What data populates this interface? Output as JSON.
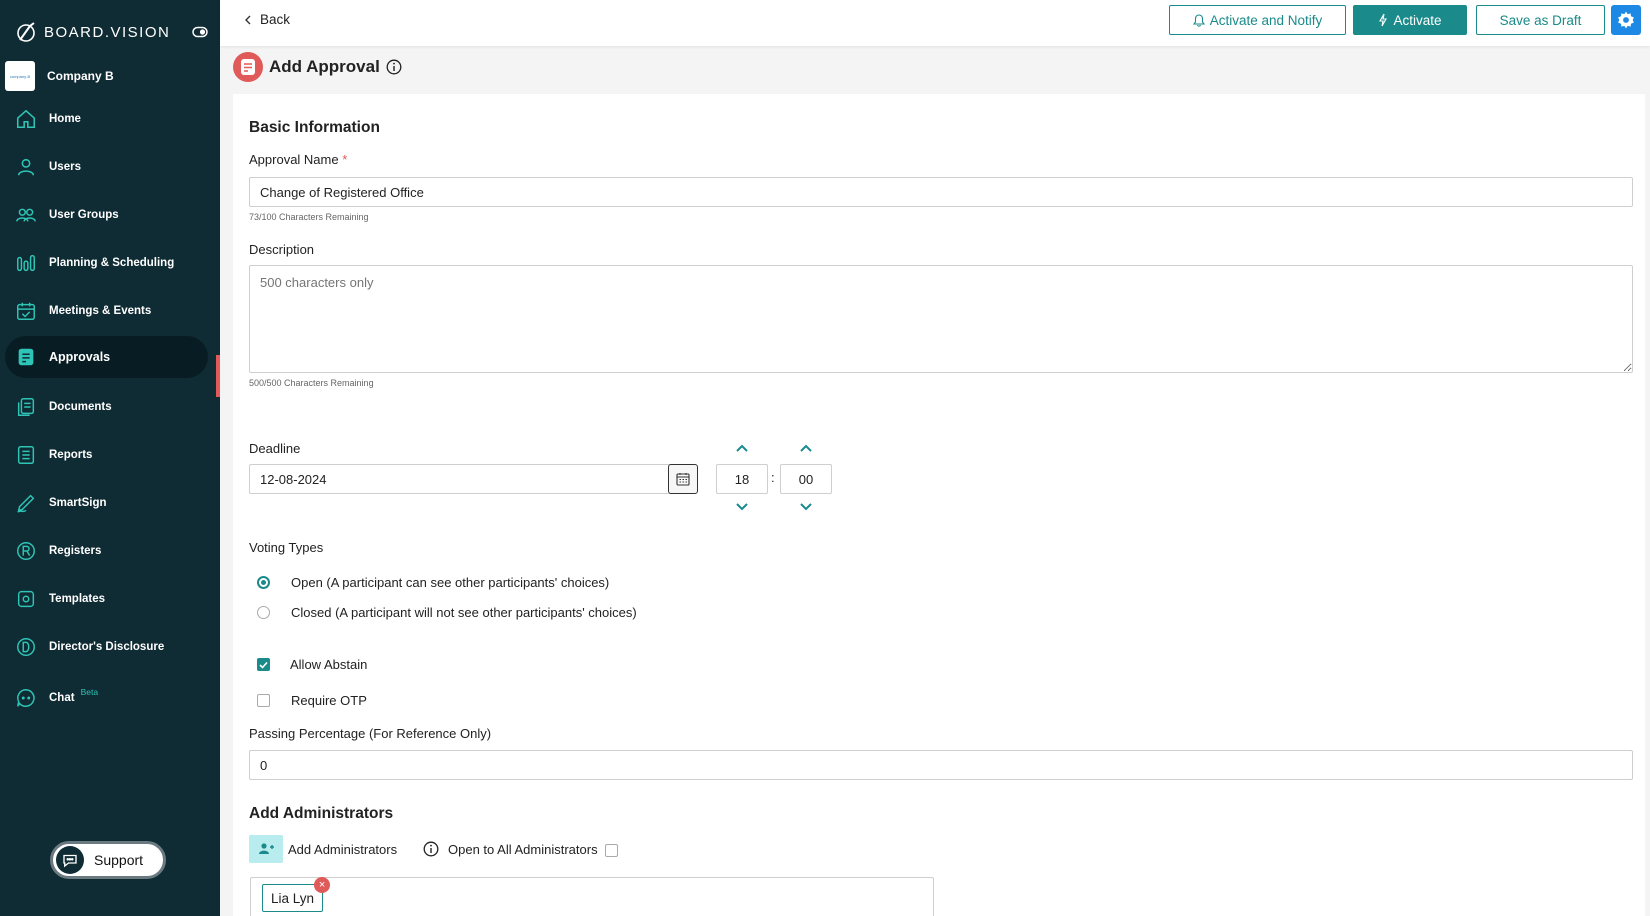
{
  "brand": {
    "name": "BOARD.VISION"
  },
  "company": {
    "name": "Company B",
    "logo_text": "company-B"
  },
  "sidebar": {
    "items": [
      {
        "label": "Home",
        "icon": "home-icon"
      },
      {
        "label": "Users",
        "icon": "user-icon"
      },
      {
        "label": "User Groups",
        "icon": "user-groups-icon"
      },
      {
        "label": "Planning & Scheduling",
        "icon": "planning-icon"
      },
      {
        "label": "Meetings & Events",
        "icon": "calendar-icon"
      },
      {
        "label": "Approvals",
        "icon": "approvals-icon",
        "active": true
      },
      {
        "label": "Documents",
        "icon": "documents-icon"
      },
      {
        "label": "Reports",
        "icon": "reports-icon"
      },
      {
        "label": "SmartSign",
        "icon": "smartsign-icon"
      },
      {
        "label": "Registers",
        "icon": "registers-icon"
      },
      {
        "label": "Templates",
        "icon": "templates-icon"
      },
      {
        "label": "Director's Disclosure",
        "icon": "disclosure-icon"
      },
      {
        "label": "Chat",
        "icon": "chat-icon",
        "badge": "Beta"
      }
    ],
    "support_label": "Support"
  },
  "toolbar": {
    "back_label": "Back",
    "activate_notify_label": "Activate and Notify",
    "activate_label": "Activate",
    "save_draft_label": "Save as Draft"
  },
  "page": {
    "title": "Add Approval"
  },
  "form": {
    "basic_info_title": "Basic Information",
    "approval_name_label": "Approval Name",
    "approval_name_required": "*",
    "approval_name_value": "Change of Registered Office",
    "approval_name_hint": "73/100 Characters Remaining",
    "description_label": "Description",
    "description_placeholder": "500 characters only",
    "description_hint": "500/500 Characters Remaining",
    "deadline_label": "Deadline",
    "deadline_date": "12-08-2024",
    "deadline_hour": "18",
    "deadline_minute": "00",
    "time_separator": ":",
    "voting_types_label": "Voting Types",
    "voting_open_label": "Open (A participant can see other participants' choices)",
    "voting_closed_label": "Closed (A participant will not see other participants' choices)",
    "voting_selected": "open",
    "allow_abstain_label": "Allow Abstain",
    "allow_abstain_checked": true,
    "require_otp_label": "Require OTP",
    "require_otp_checked": false,
    "passing_percentage_label": "Passing Percentage (For Reference Only)",
    "passing_percentage_value": "0",
    "admins_title": "Add Administrators",
    "add_admins_label": "Add Administrators",
    "open_all_admins_label": "Open to All Administrators",
    "open_all_admins_checked": false,
    "admins": [
      "Lia Lyn"
    ]
  },
  "colors": {
    "sidebar_bg": "#0f2b33",
    "accent_teal": "#1a8a8a",
    "accent_red": "#e05a5a",
    "settings_blue": "#1e88e5"
  }
}
